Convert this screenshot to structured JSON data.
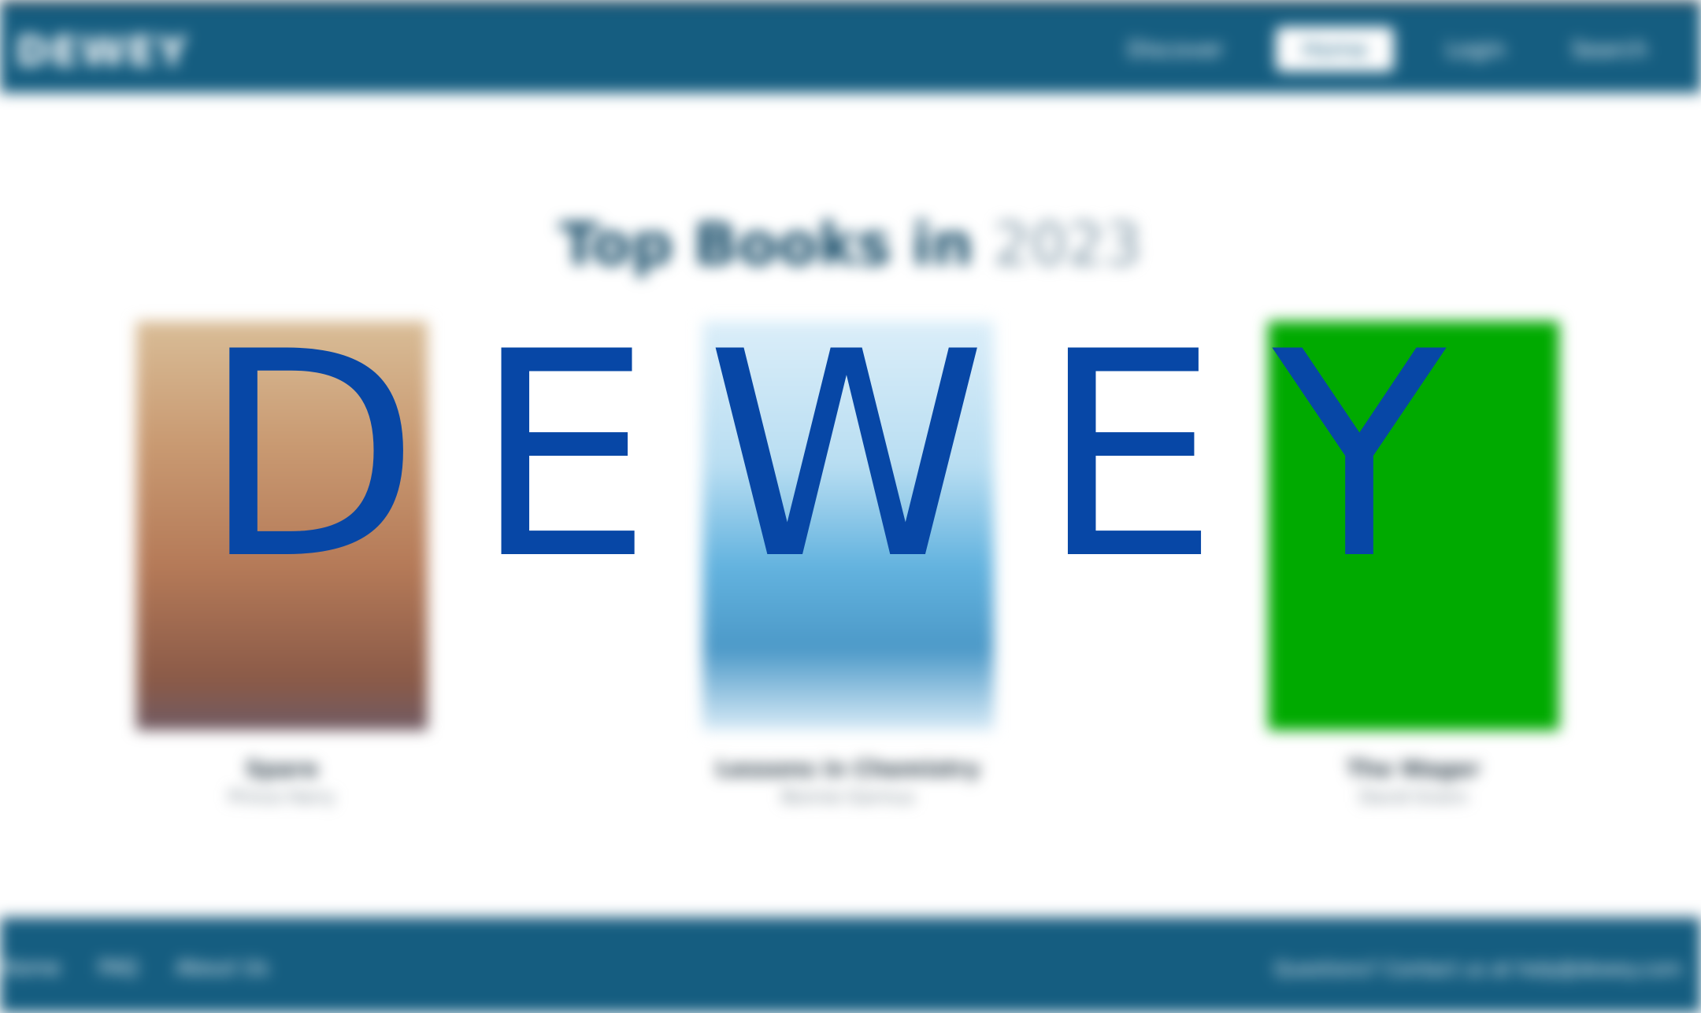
{
  "header": {
    "brand": "DEWEY",
    "nav": [
      {
        "label": "Discover",
        "active": false
      },
      {
        "label": "Home",
        "active": true
      },
      {
        "label": "Login",
        "active": false
      },
      {
        "label": "Search",
        "active": false
      }
    ]
  },
  "main": {
    "title": "Top Books in",
    "title_year": "2023",
    "books": [
      {
        "title": "Spare",
        "author": "Prince Harry"
      },
      {
        "title": "Lessons in Chemistry",
        "author": "Bonnie Garmus"
      },
      {
        "title": "The Wager",
        "author": "David Grann"
      }
    ]
  },
  "footer": {
    "links": [
      "Home",
      "FAQ",
      "About Us"
    ],
    "contact": "Questions? Contact us at help@dewey.com"
  },
  "overlay": {
    "text": "DEWEY"
  },
  "colors": {
    "header_bg": "#155d80",
    "overlay_text": "#0747a6",
    "cover_3": "#00aa00"
  }
}
